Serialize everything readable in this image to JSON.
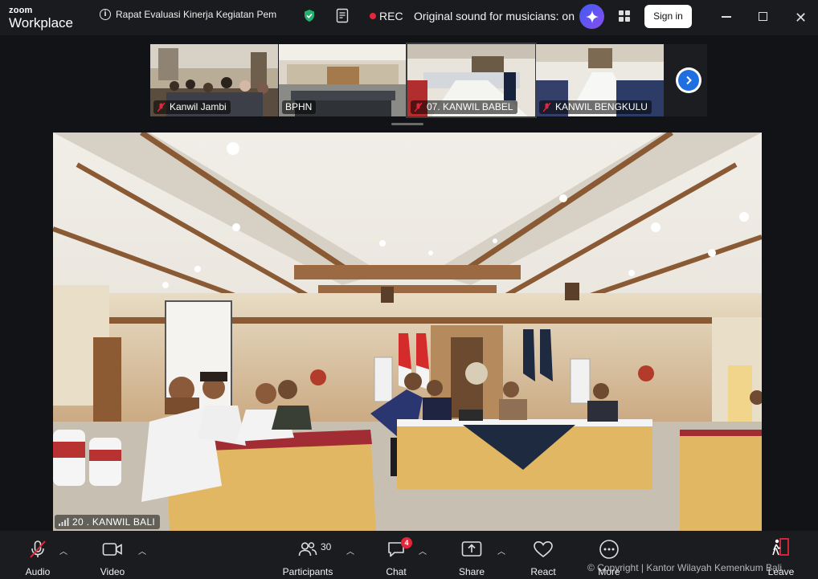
{
  "app": {
    "logo_line1": "zoom",
    "logo_line2": "Workplace"
  },
  "titlebar": {
    "meeting_title": "Rapat Evaluasi Kinerja Kegiatan Pemb",
    "rec_label": "REC",
    "sound_label": "Original sound for musicians: on",
    "signin_label": "Sign in",
    "accent_color": "#e5253a"
  },
  "gallery": {
    "tiles": [
      {
        "name": "Kanwil Jambi",
        "muted": true
      },
      {
        "name": "BPHN",
        "muted": false
      },
      {
        "name": "07. KANWIL BABEL",
        "muted": true
      },
      {
        "name": "KANWIL BENGKULU",
        "muted": true
      }
    ]
  },
  "main_video": {
    "speaker_name": "20 . KANWIL BALI"
  },
  "toolbar": {
    "audio_label": "Audio",
    "video_label": "Video",
    "participants_label": "Participants",
    "participants_count": "30",
    "chat_label": "Chat",
    "chat_badge": "4",
    "share_label": "Share",
    "react_label": "React",
    "more_label": "More",
    "leave_label": "Leave"
  },
  "watermark": "© Copyright | Kantor Wilayah Kemenkum Bali"
}
